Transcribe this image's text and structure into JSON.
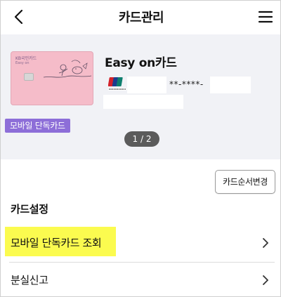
{
  "header": {
    "title": "카드관리"
  },
  "card": {
    "brand_text": "KB국민카드",
    "sub_text": "Easy on",
    "mobile_badge": "모바일 단독카드",
    "name": "Easy on카드",
    "number_masked": "**-****-",
    "network": "UnionPay",
    "pager": "1 / 2",
    "card_color": "#f5bcc9",
    "badge_color": "#8d6ed8"
  },
  "actions": {
    "order_button": "카드순서변경"
  },
  "settings": {
    "title": "카드설정",
    "items": [
      {
        "label": "모바일 단독카드 조회",
        "icon": "chevron-right-icon",
        "highlighted": true
      },
      {
        "label": "분실신고",
        "icon": "chevron-right-icon",
        "highlighted": false
      }
    ],
    "highlight_color": "#fbfb4f"
  }
}
